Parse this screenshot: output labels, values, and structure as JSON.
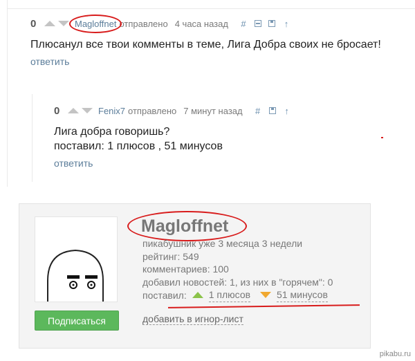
{
  "comment1": {
    "rating": "0",
    "author": "Magloffnet",
    "sent": "отправлено",
    "time": "4 часа назад",
    "hash": "#",
    "text": "Плюсанул все твои комменты в теме, Лига Добра своих не бросает!",
    "reply": "ответить"
  },
  "comment2": {
    "rating": "0",
    "author": "Fenix7",
    "sent": "отправлено",
    "time": "7 минут назад",
    "hash": "#",
    "line1": "Лига добра говоришь?",
    "line2": "поставил: 1 плюсов , 51 минусов",
    "reply": "ответить"
  },
  "profile": {
    "username": "Magloffnet",
    "tenure": "пикабушник уже 3 месяца 3 недели",
    "rating": "рейтинг: 549",
    "comments": "комментариев: 100",
    "news": "добавил новостей: 1, из них в \"горячем\": 0",
    "given_label": "поставил:",
    "pluses": "1 плюсов",
    "minuses": "51 минусов",
    "subscribe": "Подписаться",
    "ignore": "добавить в игнор-лист"
  },
  "watermark": "pikabu.ru",
  "colors": {
    "link": "#5b7d9a",
    "annotation_red": "#d81b1b",
    "subscribe_green": "#5cb85c",
    "plus_green": "#8bc34a",
    "minus_orange": "#f0a830"
  }
}
